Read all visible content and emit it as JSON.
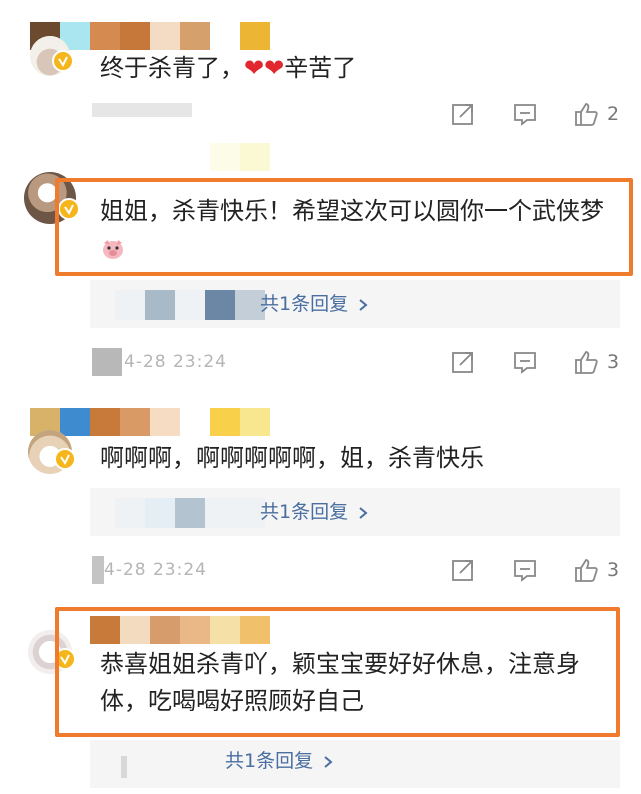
{
  "comments": [
    {
      "text": "终于杀青了，",
      "hearts": "❤❤",
      "text_after": "辛苦了",
      "reply_count": "",
      "share_count": "",
      "like_count": "2",
      "timestamp": ""
    },
    {
      "text": "姐姐，杀青快乐！希望这次可以圆你一个武侠梦",
      "reply_link": "共1条回复",
      "timestamp": "4-28 23:24",
      "like_count": "3"
    },
    {
      "text": "啊啊啊，啊啊啊啊啊，姐，杀青快乐",
      "reply_link": "共1条回复",
      "timestamp": "4-28 23:24",
      "like_count": "3"
    },
    {
      "text": "恭喜姐姐杀青吖，颖宝宝要好好休息，注意身体，吃喝喝好照顾好自己",
      "reply_link": "共1条回复"
    }
  ],
  "icons": {
    "share": "share-icon",
    "comment": "comment-icon",
    "like": "thumbs-up-icon",
    "chevron": "chevron-right-icon"
  },
  "colors": {
    "highlight": "#f07b2c",
    "link": "#4a6ea1",
    "verified": "#f5b51b"
  }
}
